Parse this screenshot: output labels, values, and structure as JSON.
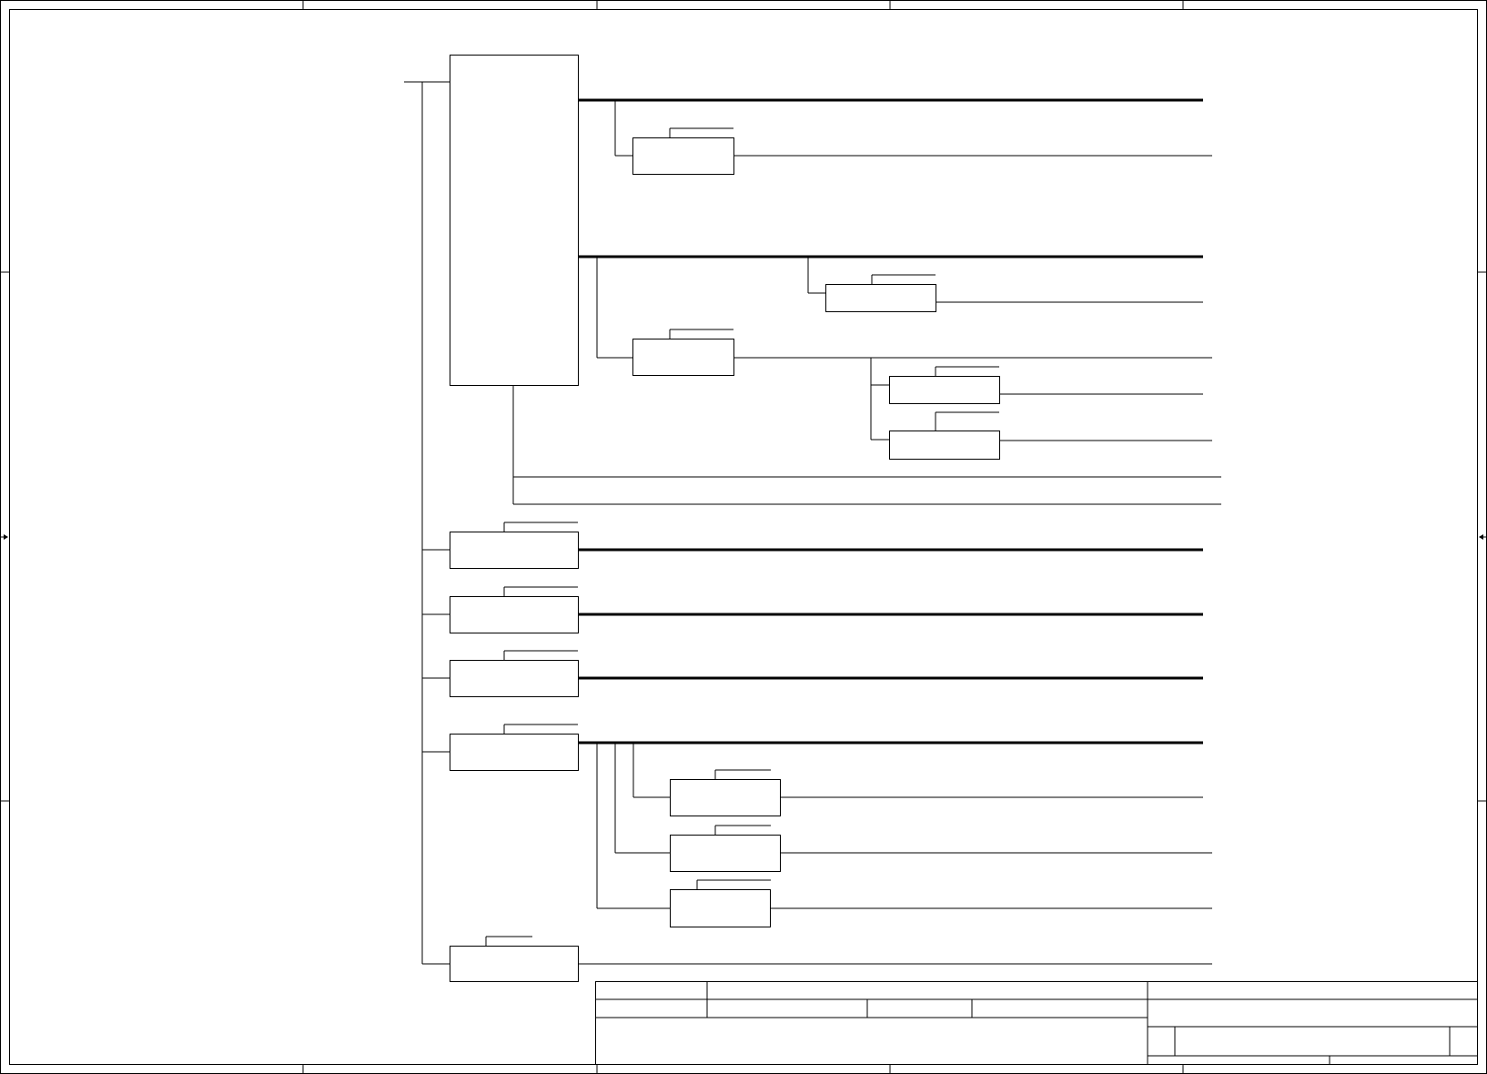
{
  "drawing": {
    "kind": "schematic-tree",
    "labels_visible": false
  },
  "colors": {
    "background": "#ffffff",
    "line": "#000000"
  }
}
